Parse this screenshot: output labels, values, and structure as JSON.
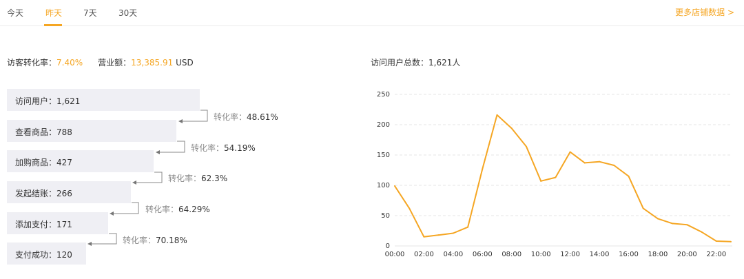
{
  "tabs": [
    {
      "label": "今天",
      "active": false
    },
    {
      "label": "昨天",
      "active": true
    },
    {
      "label": "7天",
      "active": false
    },
    {
      "label": "30天",
      "active": false
    }
  ],
  "more_link": "更多店铺数据 >",
  "stats": {
    "conversion_label": "访客转化率：",
    "conversion_value": "7.40%",
    "revenue_label": "营业额：",
    "revenue_value": "13,385.91",
    "revenue_unit": "USD"
  },
  "total_visitors": {
    "label": "访问用户总数：",
    "value": "1,621人"
  },
  "funnel": [
    {
      "label": "访问用户：1,621",
      "value": 1621
    },
    {
      "label": "查看商品：788",
      "value": 788
    },
    {
      "label": "加购商品：427",
      "value": 427
    },
    {
      "label": "发起结账：266",
      "value": 266
    },
    {
      "label": "添加支付：171",
      "value": 171
    },
    {
      "label": "支付成功：120",
      "value": 120
    }
  ],
  "conversions": [
    {
      "label": "转化率：",
      "value": "48.61%"
    },
    {
      "label": "转化率：",
      "value": "54.19%"
    },
    {
      "label": "转化率：",
      "value": "62.3%"
    },
    {
      "label": "转化率：",
      "value": "64.29%"
    },
    {
      "label": "转化率：",
      "value": "70.18%"
    }
  ],
  "colors": {
    "accent": "#f5a623",
    "bar": "#efeff4",
    "grid": "#e6e6e6"
  },
  "chart_data": {
    "type": "line",
    "x": [
      "00:00",
      "01:00",
      "02:00",
      "03:00",
      "04:00",
      "05:00",
      "06:00",
      "07:00",
      "08:00",
      "09:00",
      "10:00",
      "11:00",
      "12:00",
      "13:00",
      "14:00",
      "15:00",
      "16:00",
      "17:00",
      "18:00",
      "19:00",
      "20:00",
      "21:00",
      "22:00",
      "23:00"
    ],
    "x_tick_labels": [
      "00:00",
      "02:00",
      "04:00",
      "06:00",
      "08:00",
      "10:00",
      "12:00",
      "14:00",
      "16:00",
      "18:00",
      "20:00",
      "22:00"
    ],
    "series": [
      {
        "values": [
          99,
          62,
          15,
          18,
          21,
          31,
          127,
          216,
          194,
          164,
          107,
          113,
          155,
          137,
          139,
          133,
          115,
          62,
          45,
          37,
          35,
          23,
          8,
          7
        ]
      }
    ],
    "ylim": [
      0,
      250
    ],
    "y_ticks": [
      0,
      50,
      100,
      150,
      200,
      250
    ],
    "grid": true,
    "grid_style": "dashed-horizontal",
    "color": "#f5a623"
  }
}
